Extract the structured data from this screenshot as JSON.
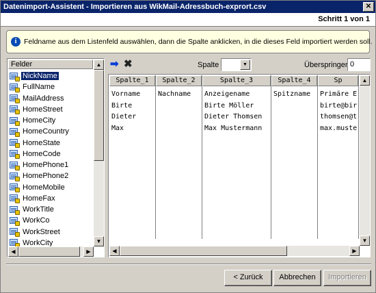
{
  "window": {
    "title": "Datenimport-Assistent - Importieren aus  WikMail-Adressbuch-exprort.csv",
    "close_glyph": "✕"
  },
  "step": "Schritt 1 von 1",
  "info": {
    "icon": "i",
    "message": "Feldname aus dem Listenfeld auswählen, dann die Spalte anklicken, in die dieses Feld importiert werden soll."
  },
  "fields": {
    "header": "Felder",
    "selected_index": 0,
    "items": [
      "NickName",
      "FullName",
      "MailAddress",
      "HomeStreet",
      "HomeCity",
      "HomeCountry",
      "HomeState",
      "HomeCode",
      "HomePhone1",
      "HomePhone2",
      "HomeMobile",
      "HomeFax",
      "WorkTitle",
      "WorkCo",
      "WorkStreet",
      "WorkCity"
    ]
  },
  "toolbar": {
    "assign_icon": "right-arrow-icon",
    "remove_icon": "x-icon",
    "column_label": "Spalte",
    "column_value": "",
    "skip_label": "Überspringen",
    "skip_value": "0"
  },
  "grid": {
    "columns": [
      {
        "header": "Spalte_1",
        "cells": [
          "Vorname",
          "Birte",
          "Dieter",
          "Max"
        ]
      },
      {
        "header": "Spalte_2",
        "cells": [
          "Nachname",
          "",
          "",
          ""
        ]
      },
      {
        "header": "Spalte_3",
        "cells": [
          "Anzeigename",
          "Birte Möller",
          "Dieter Thomsen",
          "Max Mustermann"
        ]
      },
      {
        "header": "Spalte_4",
        "cells": [
          "Spitzname",
          "",
          "",
          ""
        ]
      },
      {
        "header": "Sp",
        "cells": [
          "Primäre E",
          "birte@bir",
          "thomsen@t",
          "max.muste"
        ]
      }
    ]
  },
  "buttons": {
    "back": "< Zurück",
    "cancel": "Abbrechen",
    "import": "Importieren"
  }
}
